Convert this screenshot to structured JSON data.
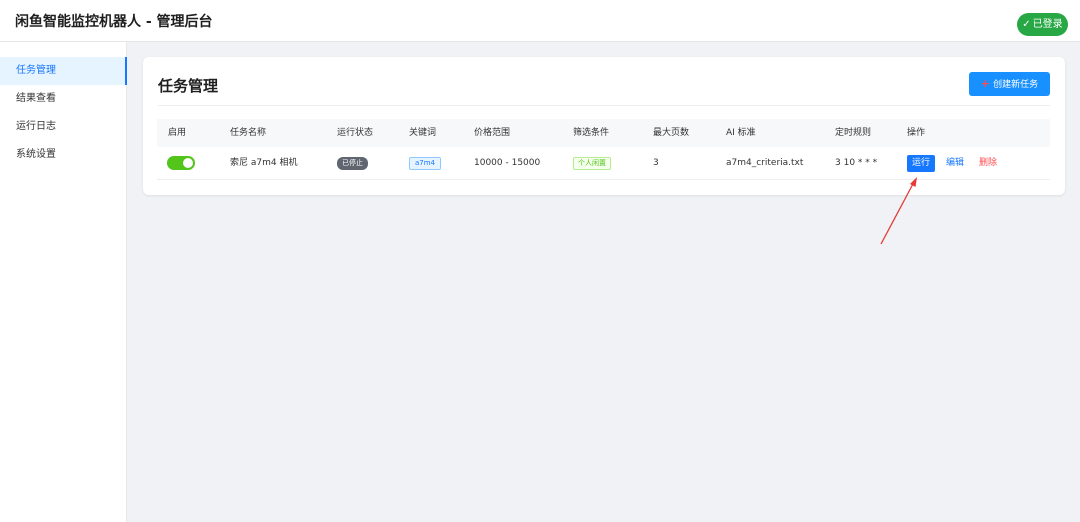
{
  "header": {
    "title": "闲鱼智能监控机器人 - 管理后台",
    "login_badge": "已登录",
    "check_icon": "✓"
  },
  "sidebar": {
    "items": [
      {
        "label": "任务管理",
        "active": true
      },
      {
        "label": "结果查看",
        "active": false
      },
      {
        "label": "运行日志",
        "active": false
      },
      {
        "label": "系统设置",
        "active": false
      }
    ]
  },
  "main": {
    "title": "任务管理",
    "create_button": "创建新任务",
    "plus_icon": "+",
    "table": {
      "columns": [
        "启用",
        "任务名称",
        "运行状态",
        "关键词",
        "价格范围",
        "筛选条件",
        "最大页数",
        "AI 标准",
        "定时规则",
        "操作"
      ],
      "rows": [
        {
          "enabled": true,
          "name": "索尼 a7m4 相机",
          "status": "已停止",
          "keyword": "a7m4",
          "price_range": "10000 - 15000",
          "filter": "个人闲置",
          "max_pages": "3",
          "ai_criteria": "a7m4_criteria.txt",
          "schedule": "3 10 * * *",
          "actions": {
            "run": "运行",
            "edit": "编辑",
            "delete": "删除"
          }
        }
      ]
    }
  },
  "colors": {
    "accent": "#1677ff",
    "success": "#27a844",
    "danger": "#ff4d4f",
    "annotation": "#e53935"
  }
}
